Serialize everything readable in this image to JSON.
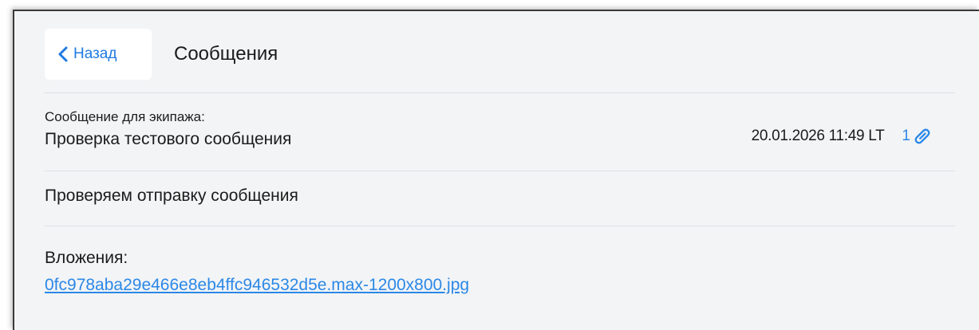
{
  "header": {
    "back_label": "Назад",
    "title": "Сообщения"
  },
  "message": {
    "caption": "Сообщение для экипажа:",
    "subject": "Проверка тестового сообщения",
    "datetime": "20.01.2026 11:49 LT",
    "attachment_count": "1",
    "body": "Проверяем отправку сообщения"
  },
  "attachments": {
    "caption": "Вложения:",
    "files": [
      "0fc978aba29e466e8eb4ffc946532d5e.max-1200x800.jpg"
    ]
  },
  "colors": {
    "accent": "#2b88e6",
    "panel_background": "#f3f4f6",
    "divider": "#dde0e4"
  },
  "icons": {
    "back": "chevron-left-icon",
    "attachment": "paperclip-icon"
  }
}
